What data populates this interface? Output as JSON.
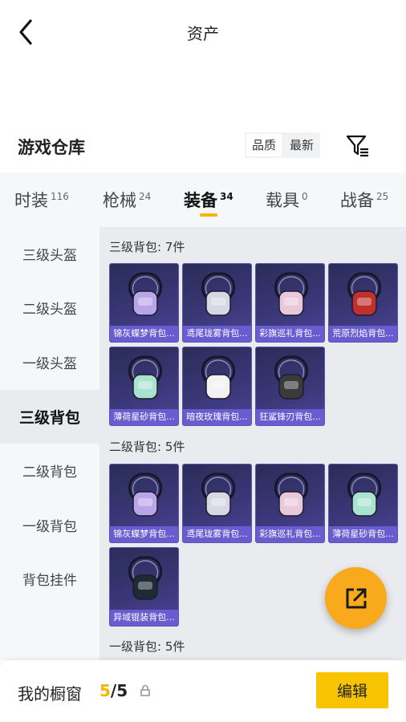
{
  "header": {
    "title": "资产",
    "back_icon": "chevron-left-icon"
  },
  "warehouse": {
    "title": "游戏仓库",
    "sort_options": [
      "品质",
      "最新"
    ],
    "selected_sort": "品质",
    "filter_icon": "filter-list-icon"
  },
  "tabs": [
    {
      "label": "时装",
      "count": "116"
    },
    {
      "label": "枪械",
      "count": "24"
    },
    {
      "label": "装备",
      "count": "34",
      "active": true
    },
    {
      "label": "载具",
      "count": "0"
    },
    {
      "label": "战备",
      "count": "25"
    }
  ],
  "sidebar": {
    "items": [
      {
        "label": "三级头盔"
      },
      {
        "label": "二级头盔"
      },
      {
        "label": "一级头盔"
      },
      {
        "label": "三级背包",
        "active": true
      },
      {
        "label": "二级背包"
      },
      {
        "label": "一级背包"
      },
      {
        "label": "背包挂件"
      }
    ]
  },
  "groups": [
    {
      "title": "三级背包: 7件",
      "items": [
        {
          "name": "锦灰蝶梦背包...",
          "color": "#b9a6e8"
        },
        {
          "name": "鸢尾珑雾背包...",
          "color": "#d8d8e4"
        },
        {
          "name": "彩旗巡礼背包...",
          "color": "#e9c9d9"
        },
        {
          "name": "荒原烈焰背包...",
          "color": "#c0302c"
        },
        {
          "name": "薄荷星砂背包...",
          "color": "#a9e2cf"
        },
        {
          "name": "暗夜玫瑰背包...",
          "color": "#f2f2f2"
        },
        {
          "name": "狂鲨锋刃背包...",
          "color": "#3a3a3a"
        }
      ]
    },
    {
      "title": "二级背包: 5件",
      "items": [
        {
          "name": "锦灰蝶梦背包...",
          "color": "#b9a6e8"
        },
        {
          "name": "鸢尾珑雾背包...",
          "color": "#d8d8e4"
        },
        {
          "name": "彩旗巡礼背包...",
          "color": "#e9c9d9"
        },
        {
          "name": "薄荷星砂背包...",
          "color": "#a9e2cf"
        },
        {
          "name": "异域锟装背包...",
          "color": "#1e2a36"
        }
      ]
    },
    {
      "title": "一级背包: 5件",
      "items": []
    }
  ],
  "fab": {
    "icon": "share-icon"
  },
  "bottom": {
    "label": "我的橱窗",
    "count_current": "5",
    "count_sep_total": "/5",
    "lock_icon": "lock-icon",
    "edit_label": "编辑"
  },
  "colors": {
    "accent": "#f5b400",
    "fab": "#f8a91c",
    "card_caption": "#6a5bd1"
  }
}
